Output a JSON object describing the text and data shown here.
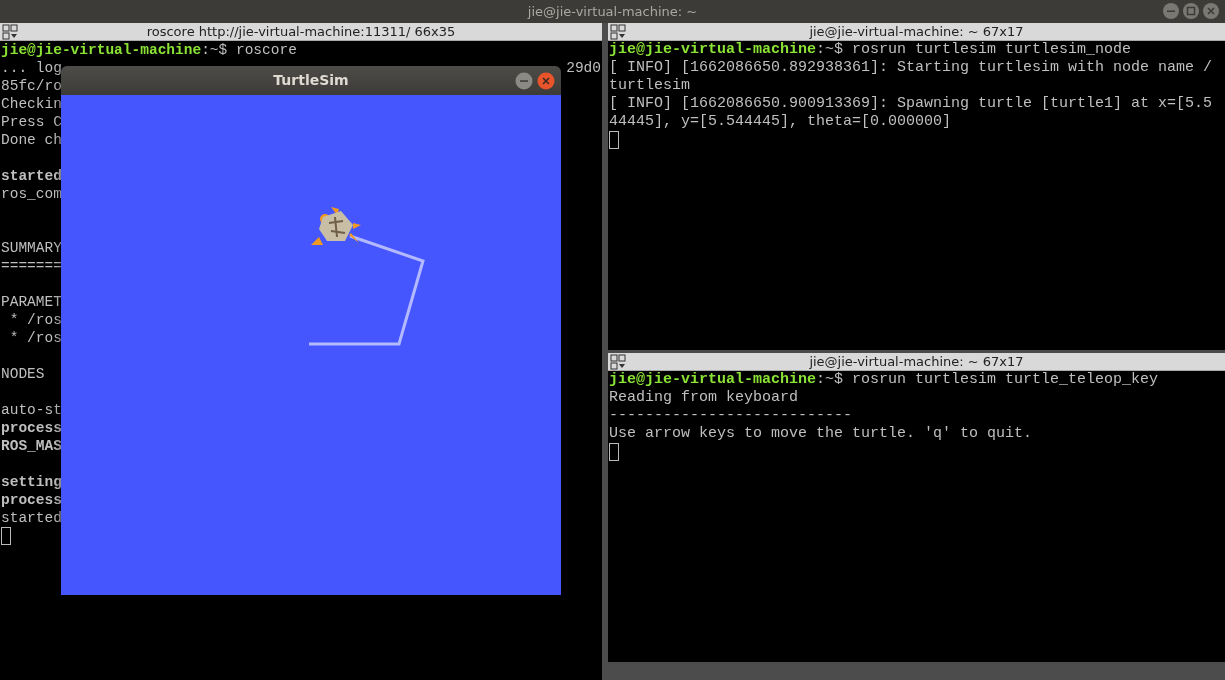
{
  "desktop_bar": {
    "title": "jie@jie-virtual-machine: ~"
  },
  "terminals": [
    {
      "title": "roscore http://jie-virtual-machine:11311/ 66x35",
      "lines": [
        {
          "kind": "prompt",
          "user": "jie@jie-virtual-machine",
          "path": ":~$",
          "command": " roscore"
        },
        {
          "kind": "split",
          "left": "... log",
          "right": "29d0"
        },
        {
          "kind": "text",
          "text": "85fc/ro",
          "bold": false
        },
        {
          "kind": "text",
          "text": "Checkin",
          "bold": false
        },
        {
          "kind": "text",
          "text": "Press C",
          "bold": false
        },
        {
          "kind": "text",
          "text": "Done ch",
          "bold": false
        },
        {
          "kind": "blank"
        },
        {
          "kind": "text",
          "text": "started",
          "bold": true
        },
        {
          "kind": "text",
          "text": "ros_com",
          "bold": false
        },
        {
          "kind": "blank"
        },
        {
          "kind": "blank"
        },
        {
          "kind": "text",
          "text": "SUMMARY",
          "bold": false
        },
        {
          "kind": "text",
          "text": "=======",
          "bold": false
        },
        {
          "kind": "blank"
        },
        {
          "kind": "text",
          "text": "PARAMET",
          "bold": false
        },
        {
          "kind": "text",
          "text": " * /ros",
          "bold": false
        },
        {
          "kind": "text",
          "text": " * /ros",
          "bold": false
        },
        {
          "kind": "blank"
        },
        {
          "kind": "text",
          "text": "NODES",
          "bold": false
        },
        {
          "kind": "blank"
        },
        {
          "kind": "text",
          "text": "auto-st",
          "bold": false
        },
        {
          "kind": "text",
          "text": "process",
          "bold": true
        },
        {
          "kind": "text",
          "text": "ROS_MAS",
          "bold": true
        },
        {
          "kind": "blank"
        },
        {
          "kind": "text",
          "text": "setting",
          "bold": true
        },
        {
          "kind": "text",
          "text": "process",
          "bold": true
        },
        {
          "kind": "text",
          "text": "started",
          "bold": false
        },
        {
          "kind": "cursor"
        }
      ]
    },
    {
      "title": "jie@jie-virtual-machine: ~ 67x17",
      "lines": [
        {
          "kind": "prompt",
          "user": "jie@jie-virtual-machine",
          "path": ":~$",
          "command": " rosrun turtlesim turtlesim_node"
        },
        {
          "kind": "text",
          "text": "[ INFO] [1662086650.892938361]: Starting turtlesim with node name /",
          "bold": false
        },
        {
          "kind": "text",
          "text": "turtlesim",
          "bold": false
        },
        {
          "kind": "text",
          "text": "[ INFO] [1662086650.900913369]: Spawning turtle [turtle1] at x=[5.5",
          "bold": false
        },
        {
          "kind": "text",
          "text": "44445], y=[5.544445], theta=[0.000000]",
          "bold": false
        },
        {
          "kind": "cursor"
        }
      ]
    },
    {
      "title": "jie@jie-virtual-machine: ~ 67x17",
      "lines": [
        {
          "kind": "prompt",
          "user": "jie@jie-virtual-machine",
          "path": ":~$",
          "command": " rosrun turtlesim turtle_teleop_key"
        },
        {
          "kind": "text",
          "text": "Reading from keyboard",
          "bold": false
        },
        {
          "kind": "text",
          "text": "---------------------------",
          "bold": false
        },
        {
          "kind": "text",
          "text": "Use arrow keys to move the turtle. 'q' to quit.",
          "bold": false
        },
        {
          "kind": "cursor"
        }
      ]
    }
  ],
  "turtlesim": {
    "title": "TurtleSim"
  }
}
